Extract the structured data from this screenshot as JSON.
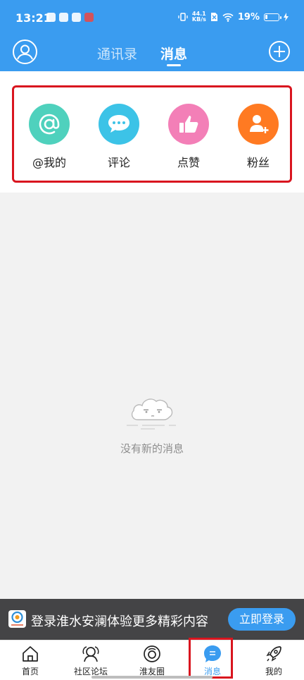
{
  "status_bar": {
    "time": "13:21",
    "net_speed_value": "44.1",
    "net_speed_unit": "KB/s",
    "battery_percent": "19%",
    "battery_level": 0.19
  },
  "nav": {
    "tabs": [
      {
        "label": "通讯录",
        "active": false
      },
      {
        "label": "消息",
        "active": true
      }
    ]
  },
  "categories": [
    {
      "label": "@我的",
      "icon": "at-icon",
      "color": "#4fd1bd"
    },
    {
      "label": "评论",
      "icon": "comment-bubble-icon",
      "color": "#3cc3e7"
    },
    {
      "label": "点赞",
      "icon": "thumbs-up-icon",
      "color": "#f37fb7"
    },
    {
      "label": "粉丝",
      "icon": "add-fan-icon",
      "color": "#ff7a22"
    }
  ],
  "empty_state": {
    "message": "没有新的消息",
    "icon": "cloud-face-icon"
  },
  "login_banner": {
    "text": "登录淮水安澜体验更多精彩内容",
    "button_label": "立即登录"
  },
  "bottom_tabs": [
    {
      "label": "首页",
      "icon": "home-icon",
      "active": false
    },
    {
      "label": "社区论坛",
      "icon": "community-icon",
      "active": false
    },
    {
      "label": "淮友圈",
      "icon": "moments-icon",
      "active": false
    },
    {
      "label": "消息",
      "icon": "message-icon",
      "active": true
    },
    {
      "label": "我的",
      "icon": "rocket-icon",
      "active": false
    }
  ],
  "colors": {
    "primary": "#3a9cf0",
    "highlight_box": "#d9151f",
    "banner_bg": "#444446"
  }
}
